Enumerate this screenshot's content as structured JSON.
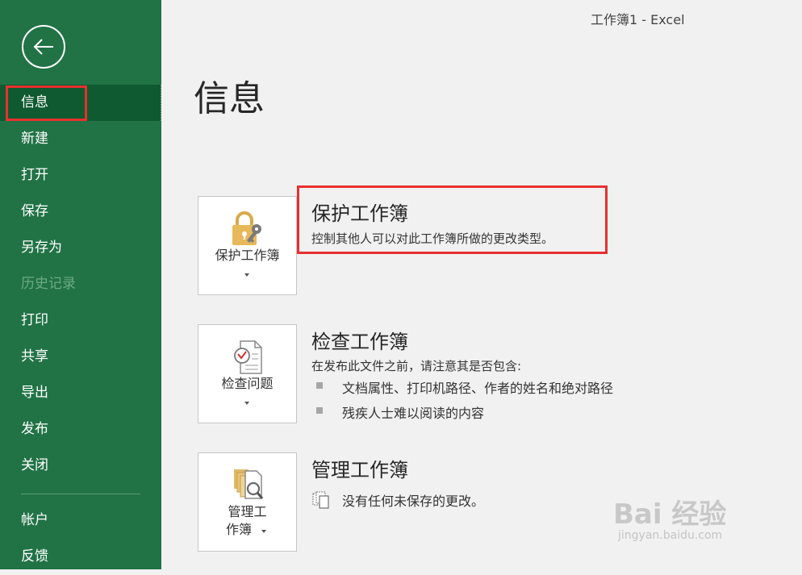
{
  "window": {
    "title": "工作簿1  -  Excel"
  },
  "sidebar": {
    "items": [
      {
        "label": "信息"
      },
      {
        "label": "新建"
      },
      {
        "label": "打开"
      },
      {
        "label": "保存"
      },
      {
        "label": "另存为"
      },
      {
        "label": "历史记录"
      },
      {
        "label": "打印"
      },
      {
        "label": "共享"
      },
      {
        "label": "导出"
      },
      {
        "label": "发布"
      },
      {
        "label": "关闭"
      }
    ],
    "bottom_items": [
      {
        "label": "帐户"
      },
      {
        "label": "反馈"
      }
    ]
  },
  "page": {
    "title": "信息"
  },
  "protect": {
    "tile_label": "保护工作簿",
    "title": "保护工作簿",
    "description": "控制其他人可以对此工作簿所做的更改类型。"
  },
  "inspect": {
    "tile_label": "检查问题",
    "title": "检查工作簿",
    "description": "在发布此文件之前，请注意其是否包含:",
    "bullets": [
      "文档属性、打印机路径、作者的姓名和绝对路径",
      "残疾人士难以阅读的内容"
    ]
  },
  "manage": {
    "tile_label_line1": "管理工",
    "tile_label_line2": "作簿",
    "title": "管理工作簿",
    "status": "没有任何未保存的更改。"
  },
  "watermark": {
    "logo": "Bai 经验",
    "url": "jingyan.baidu.com"
  },
  "colors": {
    "sidebar": "#217346",
    "highlight": "#e8302f",
    "background": "#f1f1f1"
  }
}
